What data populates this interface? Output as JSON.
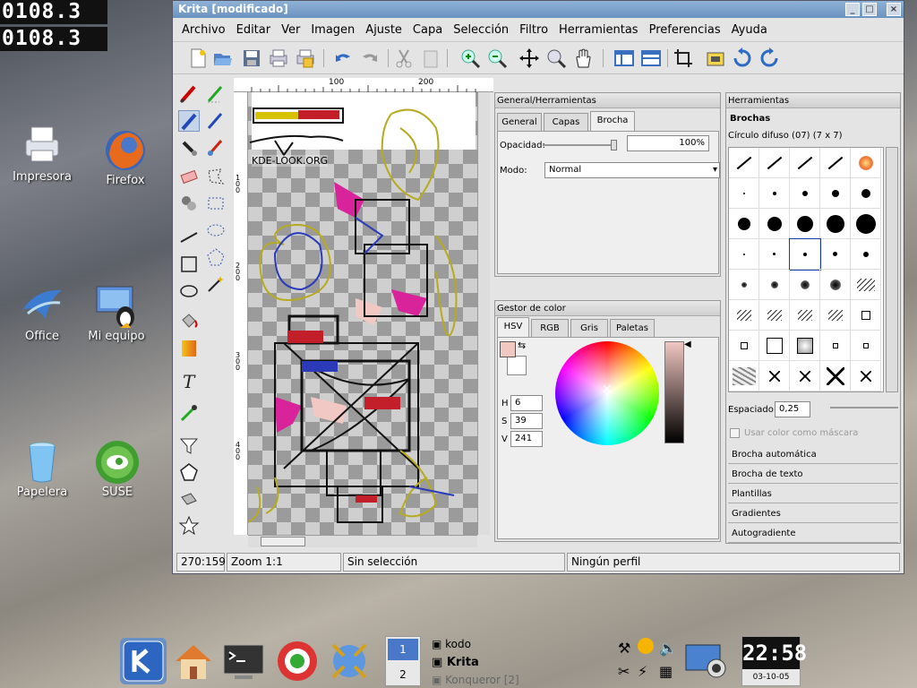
{
  "top_clock": {
    "line1": "0108.3",
    "line2": "0108.3"
  },
  "desktop_icons": [
    {
      "label": "Impresora",
      "icon": "printer-icon"
    },
    {
      "label": "Firefox",
      "icon": "firefox-icon"
    },
    {
      "label": "Office",
      "icon": "office-icon"
    },
    {
      "label": "Mi equipo",
      "icon": "computer-icon"
    },
    {
      "label": "Papelera",
      "icon": "trash-icon"
    },
    {
      "label": "SUSE",
      "icon": "suse-icon"
    }
  ],
  "window": {
    "title": "Krita [modificado]",
    "buttons": [
      "_",
      "□",
      "×"
    ]
  },
  "menu": [
    "Archivo",
    "Editar",
    "Ver",
    "Imagen",
    "Ajuste",
    "Capa",
    "Selección",
    "Filtro",
    "Herramientas",
    "Preferencias",
    "Ayuda"
  ],
  "ruler": {
    "h_100": "100",
    "h_200": "200",
    "v_100": "1 0 0",
    "v_200": "2 0 0",
    "v_300": "3 0 0",
    "v_400": "4 0 0"
  },
  "canvas": {
    "watermark": "KDE-LOOK.ORG"
  },
  "left_panel": {
    "title": "General/Herramientas",
    "tabs": [
      "General",
      "Capas",
      "Brocha"
    ],
    "active_tab": "Brocha",
    "opacity_label": "Opacidad:",
    "opacity_value": "100%",
    "opacity_fraction": 1.0,
    "mode_label": "Modo:",
    "mode_value": "Normal"
  },
  "color_panel": {
    "title": "Gestor de color",
    "tabs": [
      "HSV",
      "RGB",
      "Gris",
      "Paletas"
    ],
    "active_tab": "HSV",
    "h_label": "H",
    "h": "6",
    "s_label": "S",
    "s": "39",
    "v_label": "V",
    "v": "241",
    "fg_color": "#f1c7c2"
  },
  "right_panel": {
    "title": "Herramientas",
    "tab": "Brochas",
    "brush_name": "Círculo difuso (07) (7 x 7)",
    "spacing_label": "Espaciado:",
    "spacing_value": "0,25",
    "use_color_label": "Usar color como máscara",
    "accordion": [
      "Brocha automática",
      "Brocha de texto",
      "Plantillas",
      "Gradientes",
      "Autogradiente"
    ]
  },
  "status": {
    "coords": "270:159",
    "zoom": "Zoom 1:1",
    "selection": "Sin selección",
    "profile": "Ningún perfil"
  },
  "taskbar": {
    "pager_desktop1": "1",
    "pager_desktop2": "2",
    "tasks": [
      "kodo",
      "Krita",
      "Konqueror [2]"
    ],
    "tasks_active": "Krita",
    "clock_time": "22:58",
    "clock_date": "03-10-05"
  }
}
